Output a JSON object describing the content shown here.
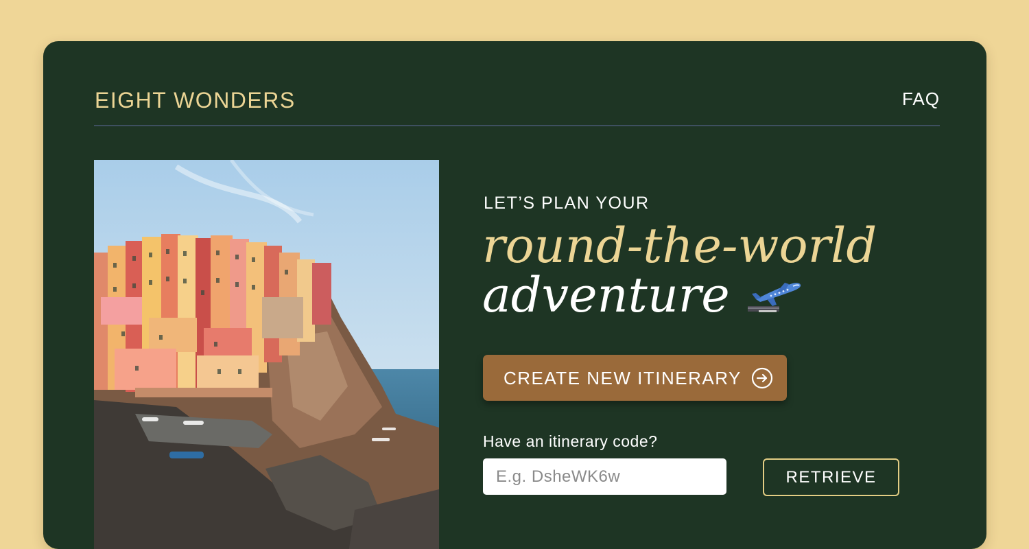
{
  "header": {
    "brand": "EIGHT WONDERS",
    "faq_label": "FAQ"
  },
  "hero": {
    "photo_alt": "",
    "eyebrow": "LET’S PLAN YOUR",
    "headline_line1": "round-the-world",
    "headline_line2": "adventure",
    "headline_icon": "airplane-departure-icon"
  },
  "actions": {
    "create_label": "CREATE NEW ITINERARY",
    "create_icon": "arrow-right-circle-icon",
    "code_prompt": "Have an itinerary code?",
    "code_placeholder": "E.g. DsheWK6w",
    "code_value": "",
    "retrieve_label": "RETRIEVE"
  },
  "colors": {
    "page_background": "#efd697",
    "card_background": "#1e3524",
    "accent_gold": "#ecd595",
    "button_brown": "#9a6a3a",
    "retrieve_border": "#e3cd84"
  }
}
